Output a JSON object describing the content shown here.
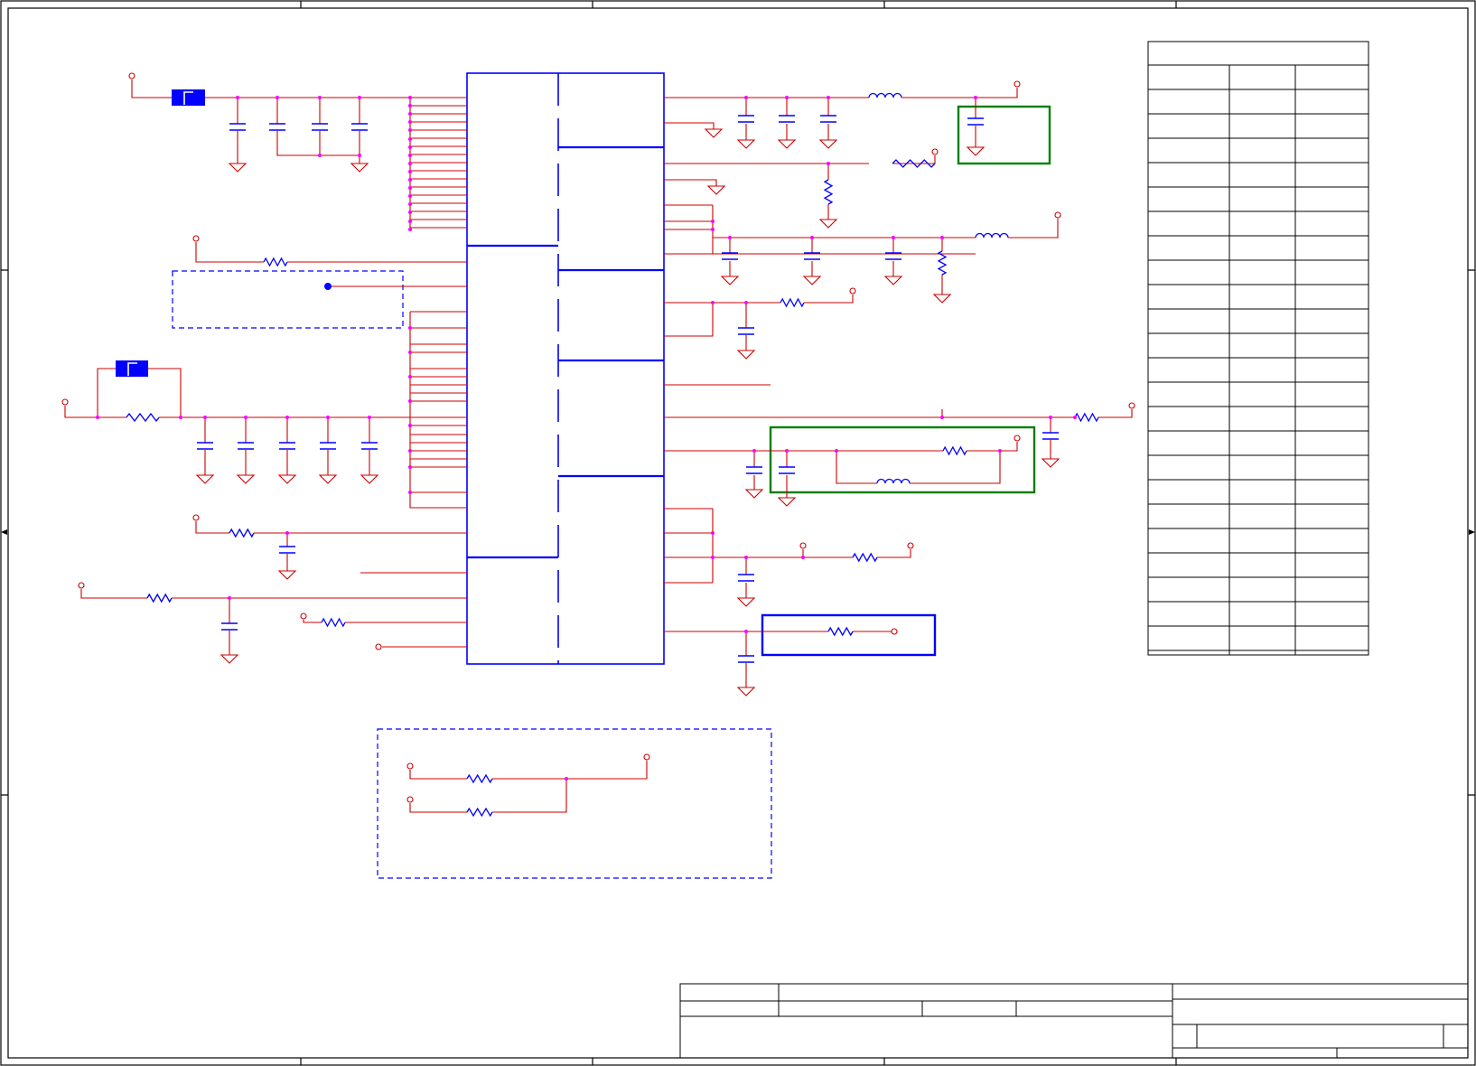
{
  "sheet": {
    "title_block": "blank",
    "revision_table": "blank",
    "text_labels": []
  },
  "colors": {
    "wire": "#cc0000",
    "net": "#990066",
    "junction": "#ff00ff",
    "component": "#0000ff",
    "part_body": "#0000ff",
    "highlight_green": "#008000",
    "highlight_blue": "#0000ff",
    "border": "#000000"
  },
  "components": {
    "ic": "main-ic",
    "fuses": 2,
    "capacitors": "many",
    "resistors": "many",
    "inductors": 4
  }
}
